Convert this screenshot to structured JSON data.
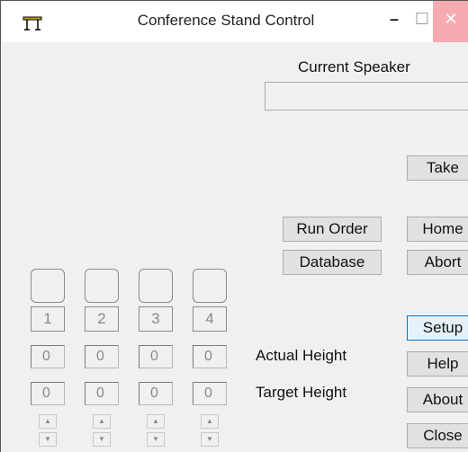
{
  "window": {
    "title": "Conference Stand Control",
    "minimize_glyph": "–",
    "maximize_glyph": "☐",
    "close_glyph": "✕",
    "icon": "conference-stand-icon"
  },
  "speaker": {
    "label": "Current Speaker",
    "value": ""
  },
  "buttons": {
    "take": "Take",
    "run_order": "Run Order",
    "home": "Home",
    "database": "Database",
    "abort": "Abort",
    "setup": "Setup",
    "help": "Help",
    "about": "About",
    "close": "Close"
  },
  "stands": [
    {
      "number": "1",
      "actual": "0",
      "target": "0"
    },
    {
      "number": "2",
      "actual": "0",
      "target": "0"
    },
    {
      "number": "3",
      "actual": "0",
      "target": "0"
    },
    {
      "number": "4",
      "actual": "0",
      "target": "0"
    }
  ],
  "height_labels": {
    "actual": "Actual Height",
    "target": "Target Height"
  },
  "spin_glyphs": {
    "up": "▲",
    "down": "▼"
  }
}
